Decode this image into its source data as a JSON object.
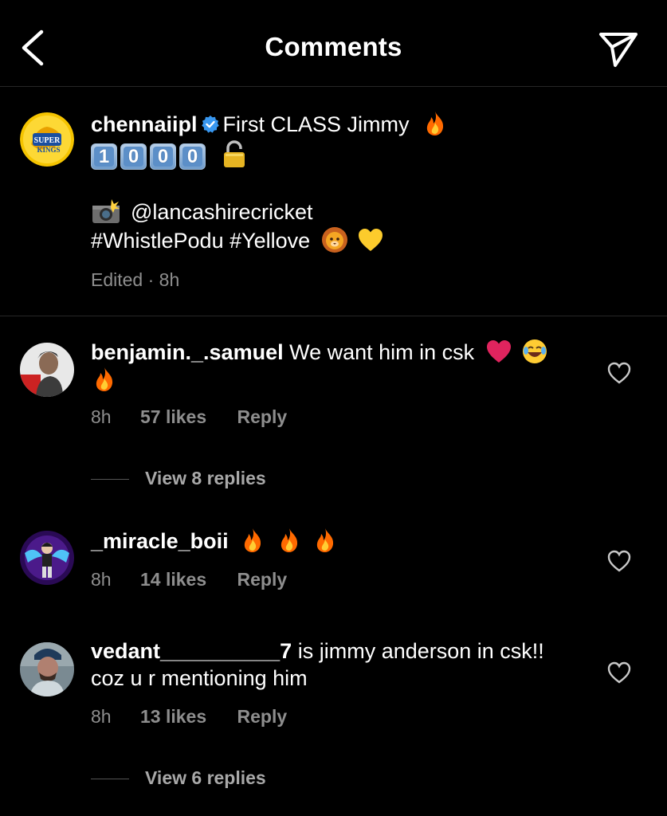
{
  "header": {
    "title": "Comments"
  },
  "caption": {
    "username": "chennaiipl",
    "text_line1": "First CLASS Jimmy",
    "digits": [
      "1",
      "0",
      "0",
      "0"
    ],
    "mention": "@lancashirecricket",
    "hashtags": "#WhistlePodu #Yellove",
    "edited": "Edited · 8h"
  },
  "comments": [
    {
      "username": "benjamin._.samuel",
      "text": "We want him in csk",
      "time": "8h",
      "likes": "57 likes",
      "reply": "Reply",
      "view_replies": "View 8 replies"
    },
    {
      "username": "_miracle_boii",
      "text": "",
      "time": "8h",
      "likes": "14 likes",
      "reply": "Reply"
    },
    {
      "username": "vedant__________7",
      "text": "is jimmy anderson in csk!!",
      "text_line2": "coz u r mentioning him",
      "time": "8h",
      "likes": "13 likes",
      "reply": "Reply",
      "view_replies": "View 6 replies"
    }
  ],
  "colors": {
    "verified": "#3897f0",
    "muted": "#8e8e8e",
    "fire": "#ff6a00",
    "heart": "#e0245e"
  }
}
